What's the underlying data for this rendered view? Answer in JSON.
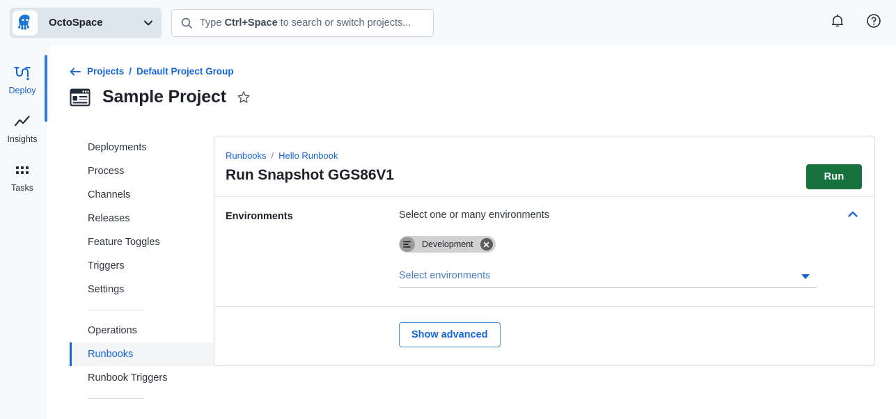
{
  "topbar": {
    "space_name": "OctoSpace",
    "logo_icon": "octopus-logo",
    "space_chevron_icon": "chevron-down-icon",
    "search": {
      "icon": "search-icon",
      "placeholder_prefix": "Type ",
      "placeholder_key": "Ctrl+Space",
      "placeholder_suffix": " to search or switch projects..."
    },
    "notifications_icon": "bell-icon",
    "help_icon": "help-circle-icon"
  },
  "rail": {
    "items": [
      {
        "label": "Deploy",
        "icon": "deploy-icon",
        "active": true
      },
      {
        "label": "Insights",
        "icon": "insights-icon",
        "active": false
      },
      {
        "label": "Tasks",
        "icon": "tasks-icon",
        "active": false
      }
    ]
  },
  "breadcrumb": {
    "back_icon": "arrow-left-icon",
    "items": [
      "Projects",
      "Default Project Group"
    ],
    "separator": "/"
  },
  "project": {
    "icon": "project-icon",
    "title": "Sample Project",
    "favorite_icon": "star-outline-icon"
  },
  "project_nav": {
    "groups": [
      {
        "items": [
          {
            "label": "Deployments",
            "active": false
          },
          {
            "label": "Process",
            "active": false
          },
          {
            "label": "Channels",
            "active": false
          },
          {
            "label": "Releases",
            "active": false
          },
          {
            "label": "Feature Toggles",
            "active": false
          },
          {
            "label": "Triggers",
            "active": false
          },
          {
            "label": "Settings",
            "active": false
          }
        ]
      },
      {
        "items": [
          {
            "label": "Operations",
            "active": false
          },
          {
            "label": "Runbooks",
            "active": true
          },
          {
            "label": "Runbook Triggers",
            "active": false
          }
        ]
      }
    ]
  },
  "card": {
    "breadcrumb": {
      "items": [
        "Runbooks",
        "Hello Runbook"
      ],
      "separator": "/"
    },
    "title": "Run Snapshot GGS86V1",
    "run_button": "Run",
    "environments": {
      "label": "Environments",
      "caption": "Select one or many environments",
      "collapse_icon": "chevron-up-icon",
      "chips": [
        {
          "label": "Development",
          "avatar_icon": "environment-icon",
          "delete_icon": "close-circle-icon"
        }
      ],
      "select_placeholder": "Select environments",
      "select_caret_icon": "caret-down-icon"
    },
    "advanced": {
      "show_advanced_label": "Show advanced"
    }
  },
  "colors": {
    "accent_blue": "#1565d8",
    "run_green": "#16723c",
    "page_bg": "#f6f8f9",
    "card_border": "#dcdfe4"
  }
}
